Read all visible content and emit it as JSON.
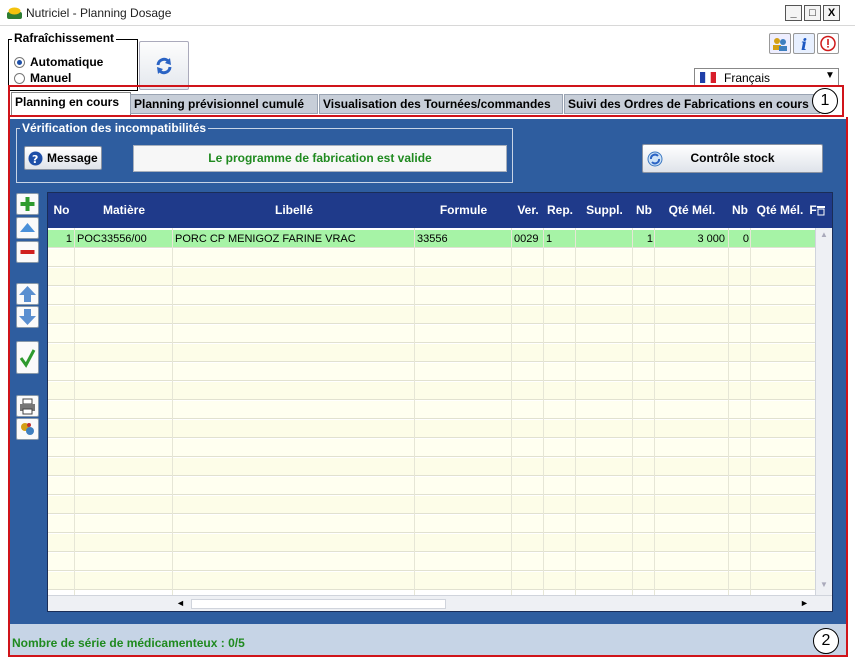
{
  "window": {
    "title": "Nutriciel - Planning Dosage",
    "min": "_",
    "max": "□",
    "close": "X"
  },
  "refresh": {
    "group_label": "Rafraîchissement",
    "opt_auto": "Automatique",
    "opt_manual": "Manuel",
    "selected": "Automatique"
  },
  "language": {
    "selected": "Français"
  },
  "tabs": [
    {
      "label": "Planning en cours",
      "active": true
    },
    {
      "label": "Planning prévisionnel cumulé",
      "active": false
    },
    {
      "label": "Visualisation des Tournées/commandes",
      "active": false
    },
    {
      "label": "Suivi des Ordres de Fabrications en cours",
      "active": false
    }
  ],
  "callouts": {
    "one": "1",
    "two": "2"
  },
  "verification": {
    "label": "Vérification des incompatibilités",
    "message_button": "Message",
    "status": "Le programme de fabrication est valide"
  },
  "stock_button": "Contrôle stock",
  "grid": {
    "columns": [
      "No",
      "Matière",
      "Libellé",
      "Formule",
      "Ver.",
      "Rep.",
      "Suppl.",
      "Nb",
      "Qté Mél.",
      "Nb",
      "Qté Mél.",
      "F"
    ],
    "rows": [
      {
        "no": "1",
        "matiere": "POC33556/00",
        "libelle": "PORC CP MENIGOZ FARINE VRAC",
        "formule": "33556",
        "ver": "0029",
        "rep": "1",
        "suppl": "",
        "nb": "1",
        "qte_mel": "3 000",
        "nb2": "0",
        "qte_mel2": ""
      }
    ]
  },
  "status": "Nombre de série de médicamenteux : 0/5",
  "colors": {
    "panel": "#2e5d9f",
    "grid_header": "#1f3a8a",
    "selected_row": "#a6f3a6",
    "valid_text": "#1f8a1f",
    "callout_border": "#d0141a"
  }
}
